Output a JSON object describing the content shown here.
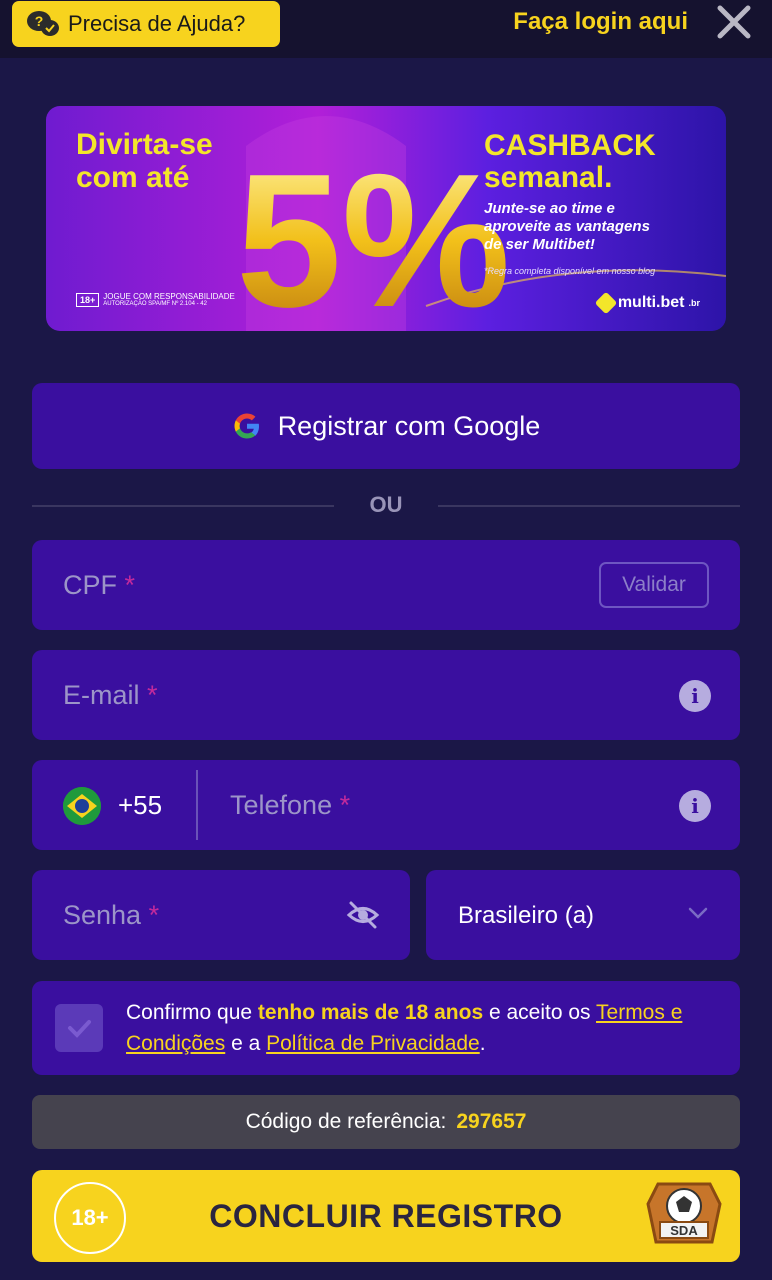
{
  "header": {
    "help_label": "Precisa de Ajuda?",
    "login_label": "Faça login aqui"
  },
  "banner": {
    "left_line1": "Divirta-se",
    "left_line2": "com até",
    "percent": "5%",
    "right_title1": "CASHBACK",
    "right_title2": "semanal.",
    "right_sub1": "Junte-se ao time e",
    "right_sub2": "aproveite as vantagens",
    "right_sub3": "de ser Multibet!",
    "rule": "*Regra completa disponível em nosso blog",
    "age": "18+",
    "responsible": "JOGUE COM RESPONSABILIDADE",
    "authorization": "AUTORIZAÇÃO SPA/MF Nº 2.104 - 42",
    "logo": "multi.bet",
    "logo_suffix": ".br"
  },
  "google_btn": {
    "label": "Registrar com Google"
  },
  "divider": {
    "label": "OU"
  },
  "cpf": {
    "placeholder": "CPF",
    "required": "*",
    "validate_label": "Validar"
  },
  "email": {
    "placeholder": "E-mail",
    "required": "*",
    "info": "i"
  },
  "phone": {
    "country_code": "+55",
    "placeholder": "Telefone",
    "required": "*",
    "info": "i"
  },
  "password": {
    "placeholder": "Senha",
    "required": "*"
  },
  "nationality": {
    "value": "Brasileiro (a)"
  },
  "terms": {
    "part1": "Confirmo que ",
    "highlight": "tenho mais de 18 anos",
    "part2": " e aceito os ",
    "link_terms": "Termos e Condições",
    "part3": " e a ",
    "link_privacy": "Política de Privacidade",
    "part4": "."
  },
  "referral": {
    "label": "Código de referência:",
    "code": "297657"
  },
  "submit": {
    "label": "CONCLUIR REGISTRO",
    "age_badge": "18+",
    "sda_label": "SDA"
  },
  "colors": {
    "accent": "#f7d31e",
    "field_bg": "#3a0f9f",
    "page_bg": "#1b1747"
  }
}
